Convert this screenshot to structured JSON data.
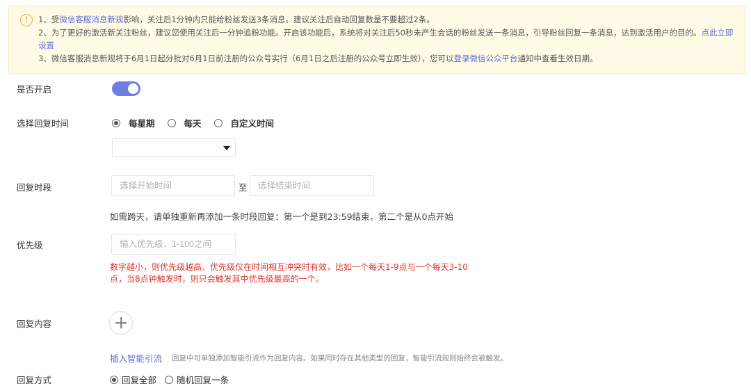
{
  "notice": {
    "line1_prefix": "1、受",
    "line1_link": "微信客服消息新规",
    "line1_suffix": "影响，关注后1分钟内只能给粉丝发送3条消息。建议关注后自动回复数量不要超过2条。",
    "line2_main": "2、为了更好的激活新关注粉丝，建议您使用关注后一分钟追粉功能。开启该功能后，系统将对关注后50秒未产生会话的粉丝发送一条消息，引导粉丝回复一条消息，达到激活用户的目的。",
    "line2_link": "点此立即设置",
    "line3_prefix": "3、微信客服消息新规将于6月1日起分批对6月1日前注册的公众号实行（6月1日之后注册的公众号立即生效），您可以",
    "line3_link": "登录微信公众平台",
    "line3_suffix": "通知中查看生效日期。"
  },
  "enable": {
    "label": "是否开启",
    "on": true
  },
  "schedule": {
    "label": "选择回复时间",
    "options": [
      "每星期",
      "每天",
      "自定义时间"
    ],
    "selected": "每星期",
    "dropdown_value": ""
  },
  "period": {
    "label": "回复时段",
    "start_placeholder": "选择开始时间",
    "separator": "至",
    "end_placeholder": "选择结束时间",
    "hint": "如需跨天，请单独重新再添加一条时段回复：第一个是到23:59结束，第二个是从0点开始"
  },
  "priority": {
    "label": "优先级",
    "placeholder": "输入优先级，1-100之间",
    "warning": "数字越小，则优先级越高。优先级仅在时间相互冲突时有效，比如一个每天1-9点与一个每天3-10点，当8点钟触发时，则只会触发其中优先级最高的一个。"
  },
  "content": {
    "label": "回复内容",
    "insert_link": "插入智能引流",
    "insert_desc": "回复中可单独添加智能引流作为回复内容。如果同时存在其他类型的回复，智能引流规则始终会被触发。"
  },
  "mode": {
    "label": "回复方式",
    "options": [
      "回复全部",
      "随机回复一条"
    ],
    "selected": "回复全部"
  },
  "colors": {
    "accent": "#6d7fe3",
    "link": "#5b6fd6",
    "warning": "#e0342c",
    "notice_bg": "#fffbe6",
    "notice_icon": "#f2a93b"
  },
  "icons": {
    "notice": "exclamation-circle-icon",
    "dropdown": "caret-down-icon",
    "add": "plus-icon"
  }
}
